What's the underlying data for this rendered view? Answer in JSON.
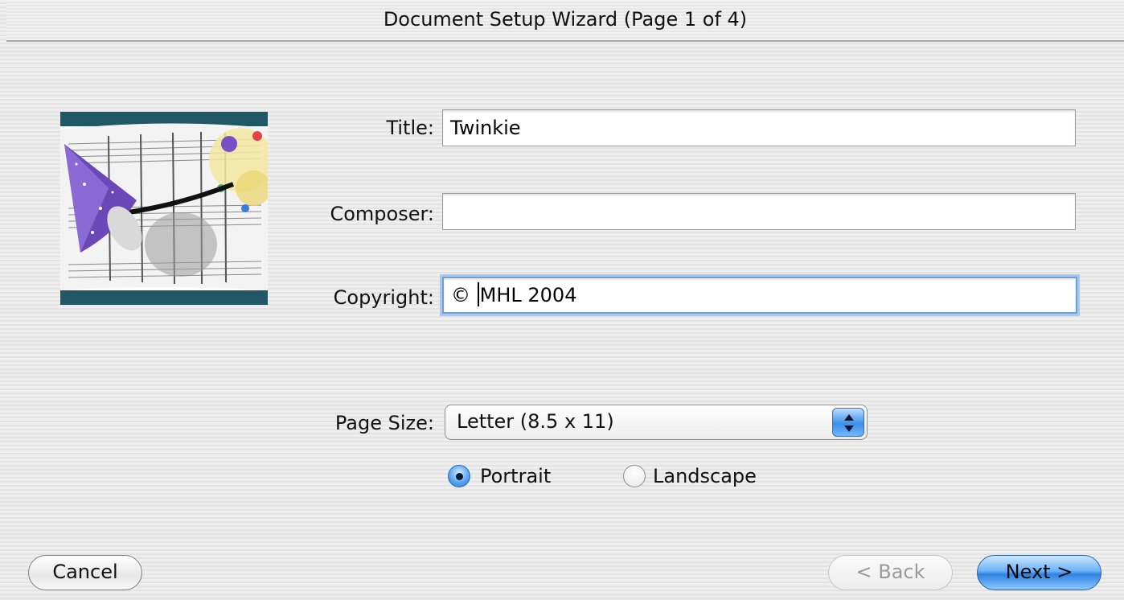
{
  "window": {
    "title": "Document Setup Wizard (Page 1 of 4)"
  },
  "form": {
    "title_label": "Title:",
    "title_value": "Twinkie",
    "composer_label": "Composer:",
    "composer_value": "",
    "copyright_label": "Copyright:",
    "copyright_value_before_caret": "©",
    "copyright_value_after_caret": "MHL 2004",
    "page_size_label": "Page Size:",
    "page_size_selected": "Letter (8.5 x 11)"
  },
  "orientation": {
    "options": [
      {
        "label": "Portrait",
        "selected": true
      },
      {
        "label": "Landscape",
        "selected": false
      }
    ]
  },
  "buttons": {
    "cancel_label": "Cancel",
    "back_label": "< Back",
    "back_enabled": false,
    "next_label": "Next >",
    "next_default": true
  },
  "icons": {
    "illustration": "wizard-hat-sheet-music-illustration",
    "popup_arrows": "updown-arrows-icon"
  },
  "colors": {
    "accent_blue": "#3d8fe8",
    "focus_ring": "#a9c8ef",
    "disabled_text": "#9a9a9a"
  }
}
